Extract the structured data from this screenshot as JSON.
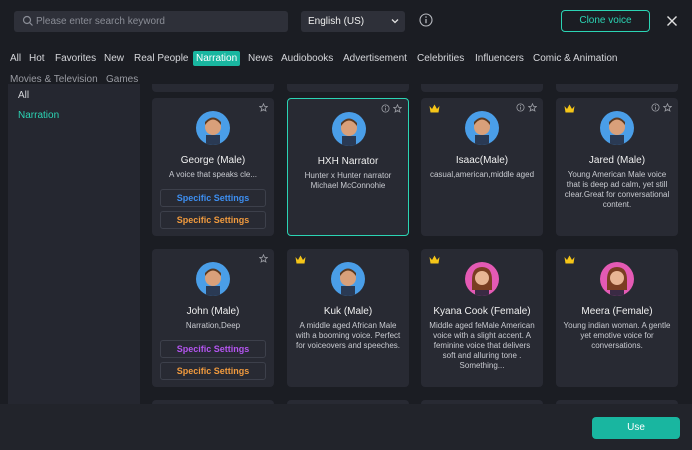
{
  "search": {
    "placeholder": "Please enter search keyword",
    "value": ""
  },
  "language": {
    "selected": "English (US)"
  },
  "clone_button": "Clone voice",
  "tabs": [
    "All",
    "Hot",
    "Favorites",
    "New",
    "Real People",
    "Narration",
    "News",
    "Audiobooks",
    "Advertisement",
    "Celebrities",
    "Influencers",
    "Comic & Animation",
    "Movies & Television",
    "Games"
  ],
  "active_tab": "Narration",
  "sidebar": {
    "items": [
      "All",
      "Narration"
    ],
    "active": "Narration"
  },
  "voices": [
    {
      "name": "George (Male)",
      "desc": "A voice that speaks cle...",
      "premium": false,
      "settings": [
        "Specific Settings",
        "Specific Settings"
      ],
      "avatar": "male"
    },
    {
      "name": "HXH Narrator",
      "desc": "Hunter x Hunter narrator\nMichael McConnohie",
      "premium": false,
      "selected": true,
      "avatar": "male"
    },
    {
      "name": "Isaac(Male)",
      "desc": "casual,american,middle aged",
      "premium": true,
      "avatar": "male"
    },
    {
      "name": "Jared (Male)",
      "desc": "Young American Male voice that is deep ad calm, yet still clear.Great for conversational content.",
      "premium": true,
      "avatar": "male"
    },
    {
      "name": "John (Male)",
      "desc": "Narration,Deep",
      "premium": false,
      "settings": [
        "Specific Settings",
        "Specific Settings"
      ],
      "avatar": "male"
    },
    {
      "name": "Kuk (Male)",
      "desc": "A middle aged African Male with a booming voice. Perfect for voiceovers and speeches.",
      "premium": true,
      "avatar": "male"
    },
    {
      "name": "Kyana Cook (Female)",
      "desc": "Middle aged feMale American voice with a slight accent. A feminine voice that delivers soft and alluring tone . Something...",
      "premium": true,
      "avatar": "female"
    },
    {
      "name": "Meera (Female)",
      "desc": "Young indian woman. A gentle yet emotive voice for conversations.",
      "premium": true,
      "avatar": "female"
    }
  ],
  "use_button": "Use",
  "colors": {
    "accent": "#19b6a0",
    "accent_border": "#2bd4b4",
    "card": "#282a33",
    "crown": "#f5c518"
  }
}
